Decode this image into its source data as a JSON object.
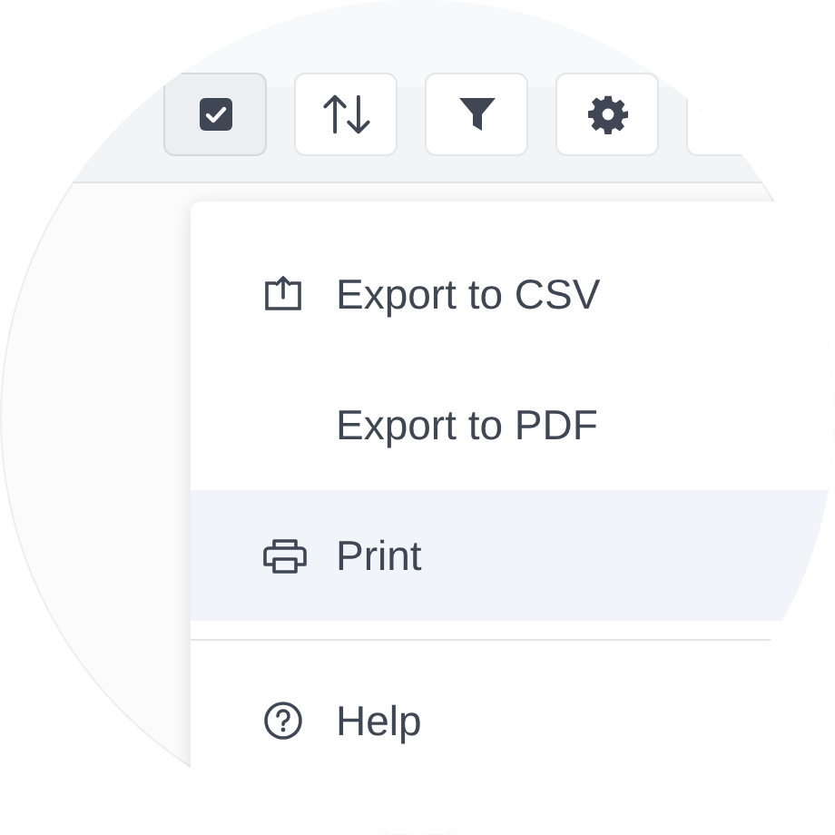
{
  "toolbar": {
    "buttons": [
      {
        "kind": "checkbox",
        "selected": true
      },
      {
        "kind": "sort",
        "selected": false
      },
      {
        "kind": "filter",
        "selected": false
      },
      {
        "kind": "settings",
        "selected": false
      },
      {
        "kind": "blank",
        "selected": false
      }
    ]
  },
  "menu": {
    "sections": [
      {
        "items": [
          {
            "kind": "export",
            "label": "Export to CSV",
            "selected": false
          },
          {
            "kind": "plain",
            "label": "Export to PDF",
            "selected": false
          },
          {
            "kind": "print",
            "label": "Print",
            "selected": true
          }
        ]
      },
      {
        "items": [
          {
            "kind": "help",
            "label": "Help",
            "selected": false
          }
        ]
      }
    ]
  }
}
